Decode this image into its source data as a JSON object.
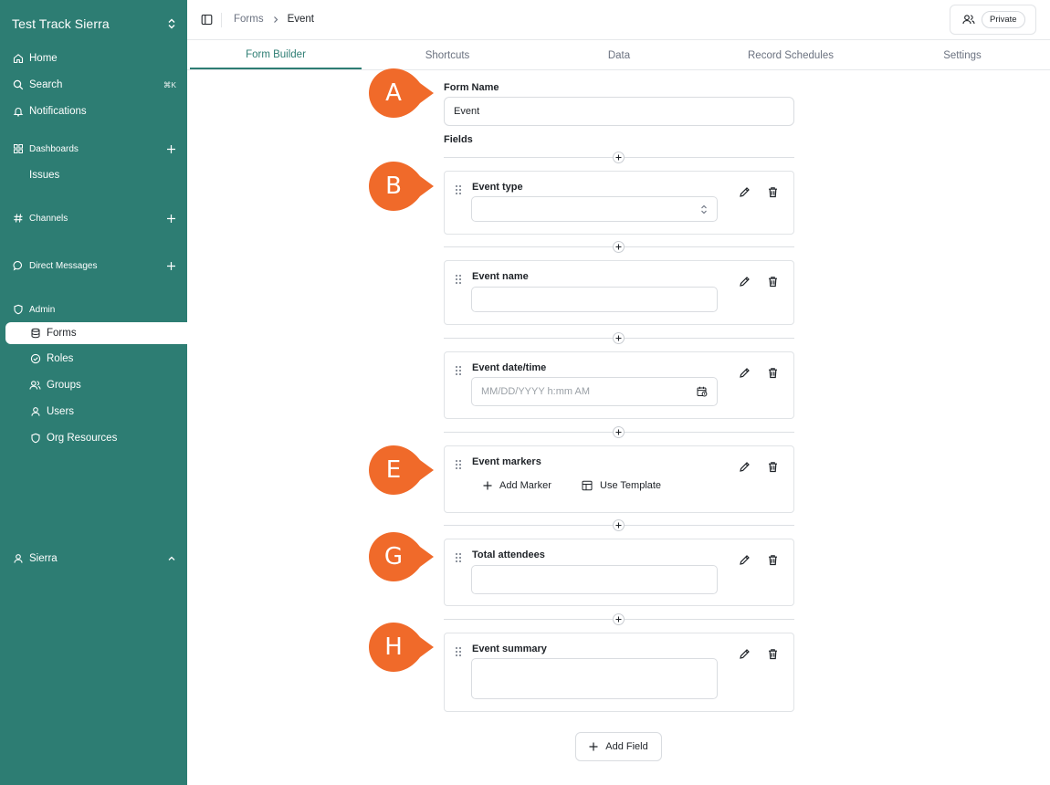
{
  "sidebar": {
    "workspace": "Test Track Sierra",
    "home": "Home",
    "search": "Search",
    "search_shortcut": "⌘K",
    "notifications": "Notifications",
    "dashboards": "Dashboards",
    "issues": "Issues",
    "channels": "Channels",
    "direct_messages": "Direct Messages",
    "admin": "Admin",
    "forms": "Forms",
    "roles": "Roles",
    "groups": "Groups",
    "users": "Users",
    "org_resources": "Org Resources",
    "user_name": "Sierra",
    "bg_color": "#2d7d73"
  },
  "breadcrumb": {
    "parent": "Forms",
    "current": "Event"
  },
  "share": {
    "visibility": "Private"
  },
  "tabs": [
    {
      "label": "Form Builder",
      "active": true
    },
    {
      "label": "Shortcuts",
      "active": false
    },
    {
      "label": "Data",
      "active": false
    },
    {
      "label": "Record Schedules",
      "active": false
    },
    {
      "label": "Settings",
      "active": false
    }
  ],
  "form": {
    "name_label": "Form Name",
    "name_value": "Event",
    "fields_label": "Fields",
    "fields": [
      {
        "title": "Event type",
        "kind": "select",
        "value": ""
      },
      {
        "title": "Event name",
        "kind": "text",
        "value": ""
      },
      {
        "title": "Event date/time",
        "kind": "datetime",
        "placeholder": "MM/DD/YYYY h:mm AM"
      },
      {
        "title": "Event markers",
        "kind": "markers",
        "add_marker": "Add Marker",
        "use_template": "Use Template"
      },
      {
        "title": "Total attendees",
        "kind": "number",
        "value": ""
      },
      {
        "title": "Event summary",
        "kind": "textarea",
        "value": ""
      }
    ],
    "add_field": "Add Field"
  },
  "markers": [
    {
      "letter": "A"
    },
    {
      "letter": "B"
    },
    {
      "letter": "E"
    },
    {
      "letter": "G"
    },
    {
      "letter": "H"
    }
  ],
  "marker_color": "#f06a2a"
}
